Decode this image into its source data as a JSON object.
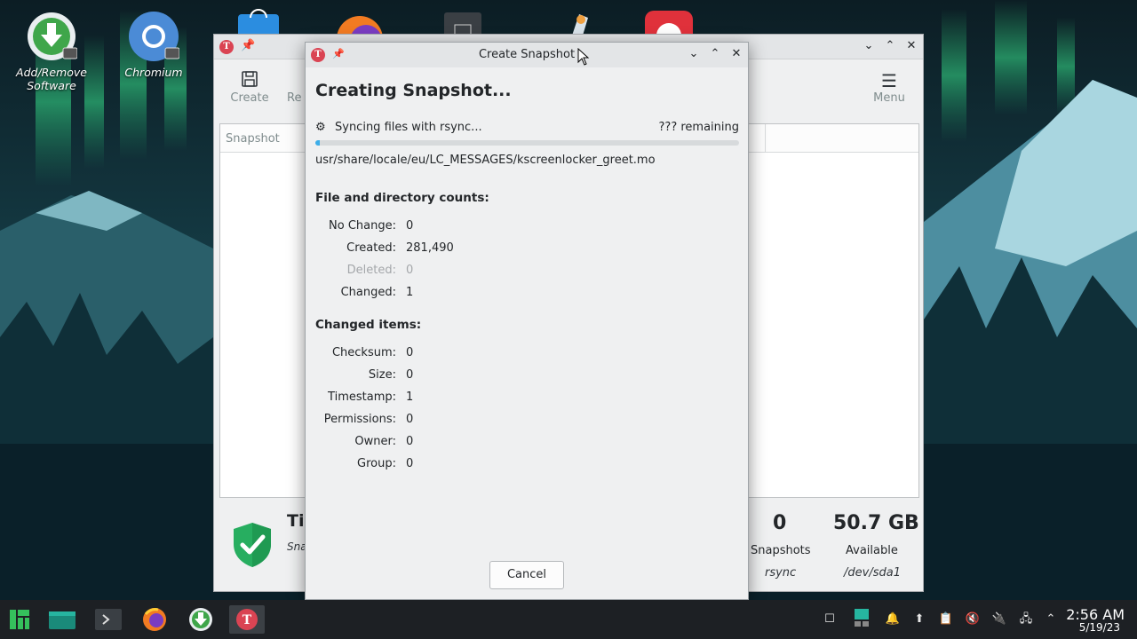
{
  "desktop": {
    "icons": [
      {
        "label_line1": "Add/Remove",
        "label_line2": "Software"
      },
      {
        "label_line1": "Chromium",
        "label_line2": ""
      }
    ]
  },
  "main_window": {
    "toolbar": {
      "create_label": "Create",
      "restore_label_partial": "Re",
      "menu_label": "Menu"
    },
    "list": {
      "column_snapshot": "Snapshot"
    },
    "status": {
      "title_partial": "Ti",
      "subtitle_partial": "Sna",
      "snapshot_count": "0",
      "snapshot_label": "Snapshots",
      "snapshot_mode": "rsync",
      "available_size": "50.7 GB",
      "available_label": "Available",
      "device": "/dev/sda1"
    }
  },
  "dialog": {
    "title": "Create Snapshot",
    "heading": "Creating Snapshot...",
    "status_text": "Syncing files with rsync...",
    "remaining": "??? remaining",
    "progress_fraction": 0.01,
    "current_file": "usr/share/locale/eu/LC_MESSAGES/kscreenlocker_greet.mo",
    "counts_heading": "File and directory counts:",
    "counts": [
      {
        "label": "No Change:",
        "value": "0",
        "dim": false
      },
      {
        "label": "Created:",
        "value": "281,490",
        "dim": false
      },
      {
        "label": "Deleted:",
        "value": "0",
        "dim": true
      },
      {
        "label": "Changed:",
        "value": "1",
        "dim": false
      }
    ],
    "changed_heading": "Changed items:",
    "changed": [
      {
        "label": "Checksum:",
        "value": "0"
      },
      {
        "label": "Size:",
        "value": "0"
      },
      {
        "label": "Timestamp:",
        "value": "1"
      },
      {
        "label": "Permissions:",
        "value": "0"
      },
      {
        "label": "Owner:",
        "value": "0"
      },
      {
        "label": "Group:",
        "value": "0"
      }
    ],
    "cancel_label": "Cancel"
  },
  "taskbar": {
    "time": "2:56 AM",
    "date": "5/19/23"
  },
  "colors": {
    "accent": "#3daee9",
    "timeshift_red": "#da4453",
    "shield_green": "#27ae60",
    "taskbar_bg": "#1d2024"
  }
}
